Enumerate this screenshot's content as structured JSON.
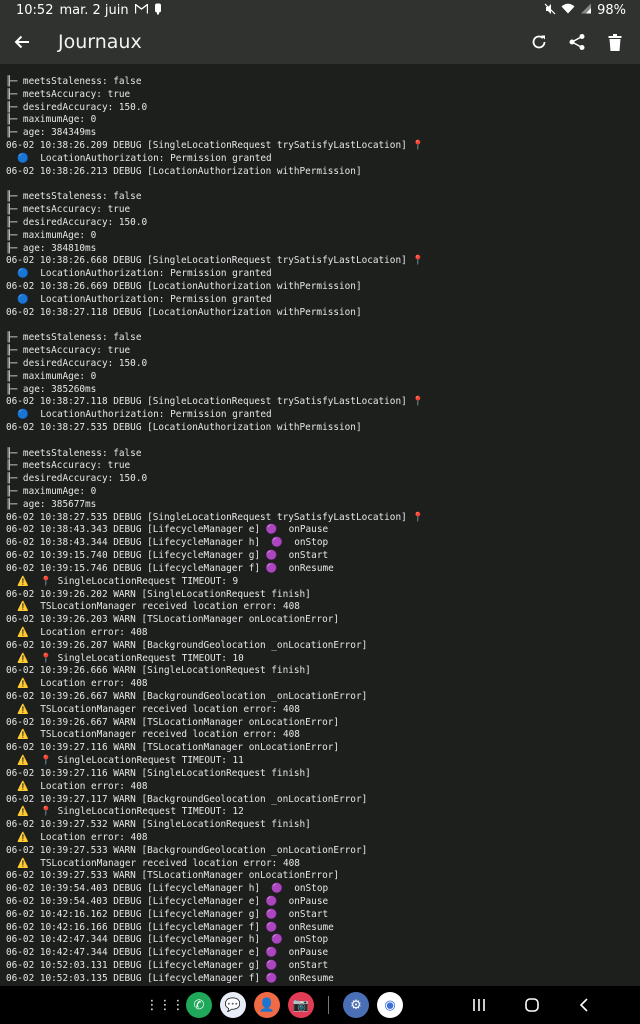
{
  "status_bar": {
    "time": "10:52",
    "date": "mar. 2 juin",
    "battery": "98%",
    "icons": [
      "gmail-icon",
      "notification-icon",
      "mute-icon",
      "wifi-icon",
      "signal-icon"
    ]
  },
  "app_bar": {
    "title": "Journaux",
    "actions": [
      "back-arrow-icon",
      "refresh-icon",
      "share-icon",
      "delete-icon"
    ]
  },
  "log_lines": [
    "╟─ meetsStaleness: false",
    "╟─ meetsAccuracy: true",
    "╟─ desiredAccuracy: 150.0",
    "╟─ maximumAge: 0",
    "╟─ age: 384349ms",
    "06-02 10:38:26.209 DEBUG [SingleLocationRequest trySatisfyLastLocation] 📍",
    "  🔵  LocationAuthorization: Permission granted",
    "06-02 10:38:26.213 DEBUG [LocationAuthorization withPermission]",
    "",
    "╟─ meetsStaleness: false",
    "╟─ meetsAccuracy: true",
    "╟─ desiredAccuracy: 150.0",
    "╟─ maximumAge: 0",
    "╟─ age: 384810ms",
    "06-02 10:38:26.668 DEBUG [SingleLocationRequest trySatisfyLastLocation] 📍",
    "  🔵  LocationAuthorization: Permission granted",
    "06-02 10:38:26.669 DEBUG [LocationAuthorization withPermission]",
    "  🔵  LocationAuthorization: Permission granted",
    "06-02 10:38:27.118 DEBUG [LocationAuthorization withPermission]",
    "",
    "╟─ meetsStaleness: false",
    "╟─ meetsAccuracy: true",
    "╟─ desiredAccuracy: 150.0",
    "╟─ maximumAge: 0",
    "╟─ age: 385260ms",
    "06-02 10:38:27.118 DEBUG [SingleLocationRequest trySatisfyLastLocation] 📍",
    "  🔵  LocationAuthorization: Permission granted",
    "06-02 10:38:27.535 DEBUG [LocationAuthorization withPermission]",
    "",
    "╟─ meetsStaleness: false",
    "╟─ meetsAccuracy: true",
    "╟─ desiredAccuracy: 150.0",
    "╟─ maximumAge: 0",
    "╟─ age: 385677ms",
    "06-02 10:38:27.535 DEBUG [SingleLocationRequest trySatisfyLastLocation] 📍",
    "06-02 10:38:43.343 DEBUG [LifecycleManager e] 🟣  onPause",
    "06-02 10:38:43.344 DEBUG [LifecycleManager h]  🟣  onStop",
    "06-02 10:39:15.740 DEBUG [LifecycleManager g] 🟣  onStart",
    "06-02 10:39:15.746 DEBUG [LifecycleManager f] 🟣  onResume",
    "  ⚠️  📍 SingleLocationRequest TIMEOUT: 9",
    "06-02 10:39:26.202 WARN [SingleLocationRequest finish]",
    "  ⚠️  TSLocationManager received location error: 408",
    "06-02 10:39:26.203 WARN [TSLocationManager onLocationError]",
    "  ⚠️  Location error: 408",
    "06-02 10:39:26.207 WARN [BackgroundGeolocation _onLocationError]",
    "  ⚠️  📍 SingleLocationRequest TIMEOUT: 10",
    "06-02 10:39:26.666 WARN [SingleLocationRequest finish]",
    "  ⚠️  Location error: 408",
    "06-02 10:39:26.667 WARN [BackgroundGeolocation _onLocationError]",
    "  ⚠️  TSLocationManager received location error: 408",
    "06-02 10:39:26.667 WARN [TSLocationManager onLocationError]",
    "  ⚠️  TSLocationManager received location error: 408",
    "06-02 10:39:27.116 WARN [TSLocationManager onLocationError]",
    "  ⚠️  📍 SingleLocationRequest TIMEOUT: 11",
    "06-02 10:39:27.116 WARN [SingleLocationRequest finish]",
    "  ⚠️  Location error: 408",
    "06-02 10:39:27.117 WARN [BackgroundGeolocation _onLocationError]",
    "  ⚠️  📍 SingleLocationRequest TIMEOUT: 12",
    "06-02 10:39:27.532 WARN [SingleLocationRequest finish]",
    "  ⚠️  Location error: 408",
    "06-02 10:39:27.533 WARN [BackgroundGeolocation _onLocationError]",
    "  ⚠️  TSLocationManager received location error: 408",
    "06-02 10:39:27.533 WARN [TSLocationManager onLocationError]",
    "06-02 10:39:54.403 DEBUG [LifecycleManager h]  🟣  onStop",
    "06-02 10:39:54.403 DEBUG [LifecycleManager e] 🟣  onPause",
    "06-02 10:42:16.162 DEBUG [LifecycleManager g] 🟣  onStart",
    "06-02 10:42:16.166 DEBUG [LifecycleManager f] 🟣  onResume",
    "06-02 10:42:47.344 DEBUG [LifecycleManager h]  🟣  onStop",
    "06-02 10:42:47.344 DEBUG [LifecycleManager e] 🟣  onPause",
    "06-02 10:52:03.131 DEBUG [LifecycleManager g] 🟣  onStart",
    "06-02 10:52:03.135 DEBUG [LifecycleManager f] 🟣  onResume"
  ],
  "nav_bar": {
    "apps": [
      {
        "name": "app-drawer-icon",
        "color": "#000000",
        "glyph": "⋮⋮⋮"
      },
      {
        "name": "phone-app-icon",
        "color": "#1fa85a",
        "glyph": "✆"
      },
      {
        "name": "messages-app-icon",
        "color": "#e8ecf6",
        "glyph": "💬"
      },
      {
        "name": "contacts-app-icon",
        "color": "#f06a46",
        "glyph": "👤"
      },
      {
        "name": "camera-app-icon",
        "color": "#e23b55",
        "glyph": "📷"
      },
      {
        "name": "settings-app-icon",
        "color": "#4a6fb5",
        "glyph": "⚙"
      },
      {
        "name": "chrome-app-icon",
        "color": "#ffffff",
        "glyph": "◉"
      }
    ],
    "system": [
      "recents-icon",
      "home-icon",
      "back-icon"
    ]
  },
  "colors": {
    "background": "#1d1f1d",
    "app_bar": "#2f322e",
    "text": "#e6e6e6"
  }
}
